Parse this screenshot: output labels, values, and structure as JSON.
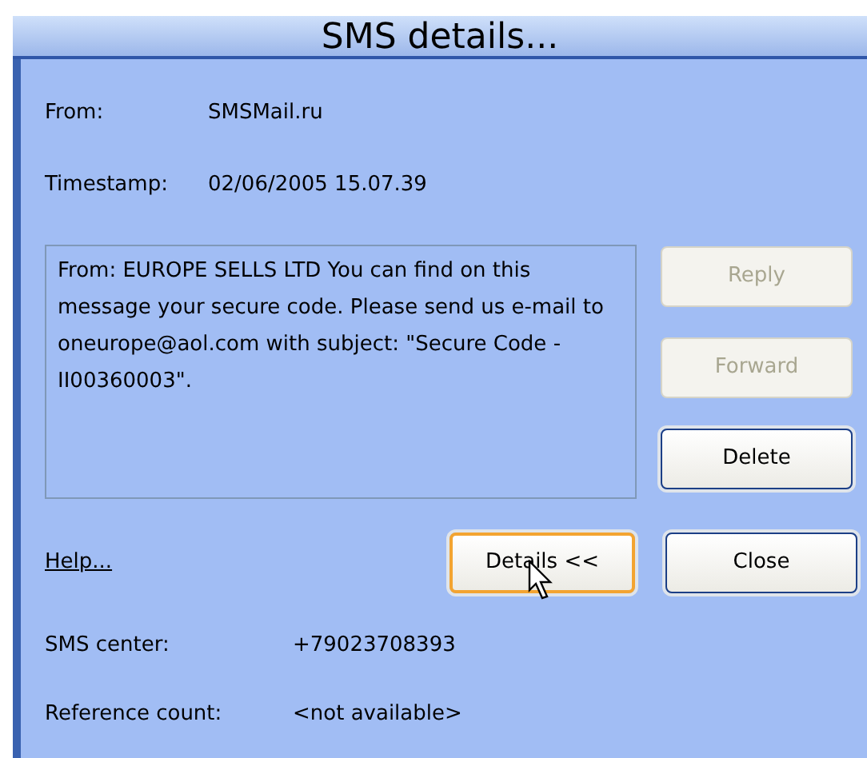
{
  "window": {
    "title": "SMS details..."
  },
  "fields": [
    {
      "label": "From:",
      "value": "SMSMail.ru"
    },
    {
      "label": "Timestamp:",
      "value": "02/06/2005 15.07.39"
    }
  ],
  "message": {
    "text": "From: EUROPE SELLS LTD You can find on this message your secure code. Please send us e-mail to oneurope@aol.com with subject: \"Secure Code - II00360003\"."
  },
  "side_buttons": [
    {
      "label": "Reply",
      "disabled": true
    },
    {
      "label": "Forward",
      "disabled": true
    },
    {
      "label": "Delete",
      "disabled": false
    }
  ],
  "help_link": "Help...",
  "bottom_buttons": [
    {
      "label": "Details <<",
      "focused": true
    },
    {
      "label": "Close",
      "focused": false
    }
  ],
  "details": [
    {
      "label": "SMS center:",
      "value": "+79023708393"
    },
    {
      "label": "Reference count:",
      "value": "<not available>"
    }
  ]
}
